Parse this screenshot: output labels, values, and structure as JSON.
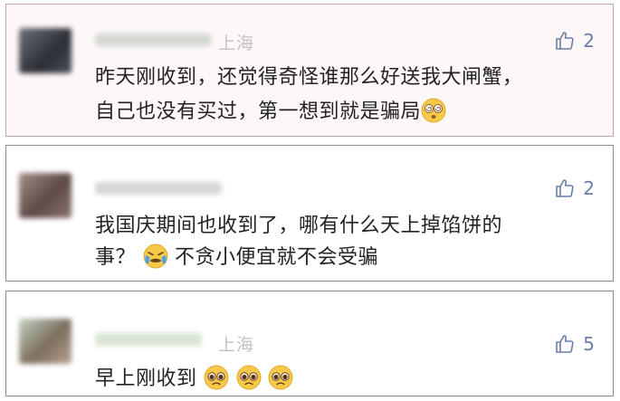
{
  "comments": [
    {
      "location": "上海",
      "likes": "2",
      "lines": [
        "昨天刚收到，还觉得奇怪谁那么好送我大闸蟹，",
        "自己也没有买过，第一想到就是骗局"
      ]
    },
    {
      "location": "",
      "likes": "2",
      "lines": [
        "我国庆期间也收到了，哪有什么天上掉馅饼的",
        "事？",
        "不贪小便宜就不会受骗"
      ]
    },
    {
      "location": "上海",
      "likes": "5",
      "lines": [
        "早上刚收到"
      ]
    }
  ],
  "icons": {
    "like": "thumbs-up-icon",
    "emoji_1": "dizzy-face-emoji",
    "emoji_2": "crying-face-emoji",
    "emoji_3": "pleading-face-emoji"
  },
  "colors": {
    "like_accent": "#6a7fa8",
    "highlight_border": "#c9a2ad",
    "emoji_yellow": "#f7c948"
  }
}
